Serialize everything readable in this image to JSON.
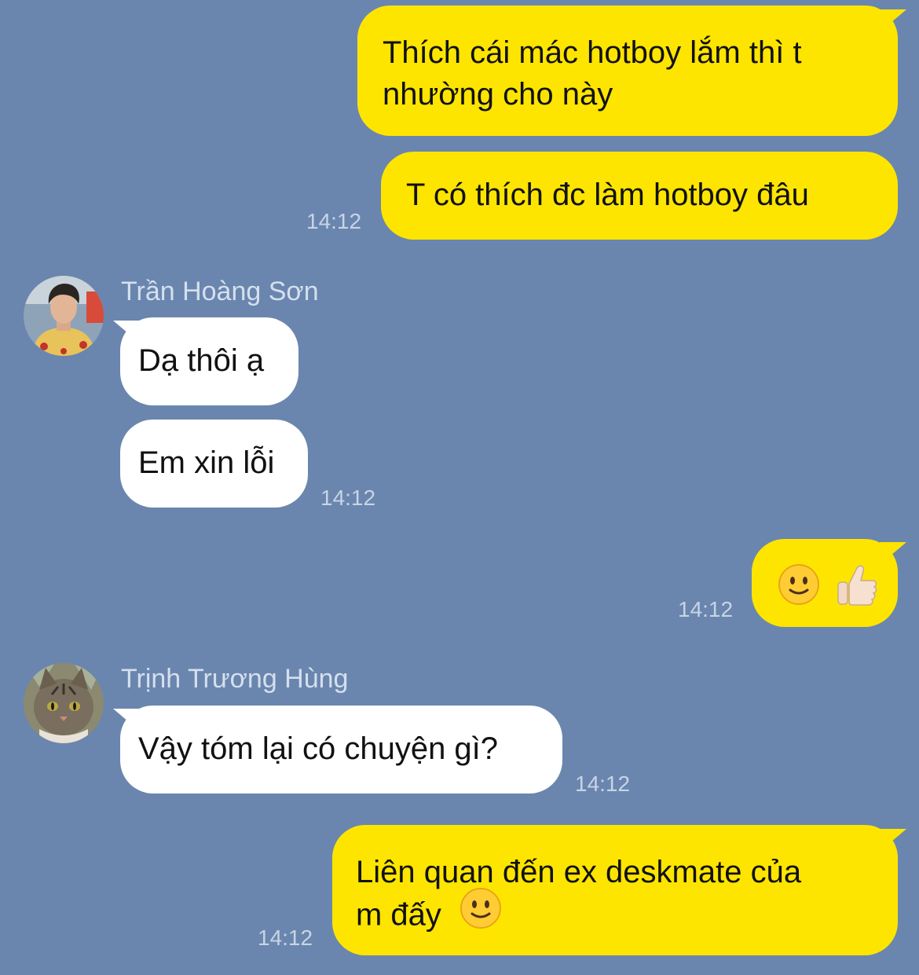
{
  "messages": [
    {
      "from": "me",
      "lines": [
        "Thích cái mác hotboy lắm thì t",
        "nhường cho này"
      ]
    },
    {
      "from": "me",
      "text": "T có thích đc làm hotboy đâu",
      "time": "14:12"
    },
    {
      "from": "Trần Hoàng Sơn",
      "text": "Dạ thôi ạ"
    },
    {
      "from": "Trần Hoàng Sơn",
      "text": "Em xin lỗi",
      "time": "14:12"
    },
    {
      "from": "me",
      "icons": [
        "slightly-smiling-face-icon",
        "thumbs-up-icon"
      ],
      "time": "14:12"
    },
    {
      "from": "Trịnh Trương Hùng",
      "text": "Vậy tóm lại có chuyện gì?",
      "time": "14:12"
    },
    {
      "from": "me",
      "lines": [
        "Liên quan đến ex deskmate của",
        "m đấy"
      ],
      "icons": [
        "slightly-smiling-face-icon"
      ],
      "time": "14:12"
    }
  ],
  "senders": {
    "son": "Trần Hoàng Sơn",
    "hung": "Trịnh Trương Hùng"
  },
  "colors": {
    "background": "#6A86AE",
    "my_bubble": "#FEE500",
    "their_bubble": "#FFFFFF",
    "timestamp": "#C8D4E6"
  }
}
